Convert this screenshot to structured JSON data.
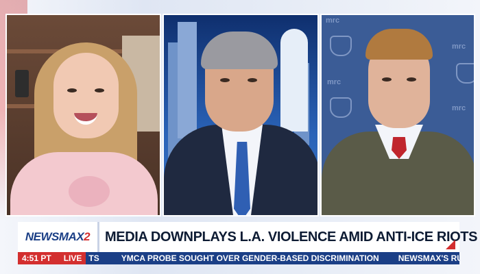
{
  "broadcast": {
    "network_logo": "NEWSMAX",
    "network_logo_num": "2",
    "headline": "MEDIA DOWNPLAYS L.A. VIOLENCE AMID ANTI-ICE RIOTS",
    "time": "4:51 PT",
    "live_label": "LIVE",
    "ticker_items": [
      "TS",
      "YMCA PROBE SOUGHT OVER GENDER-BASED DISCRIMINATION",
      "NEWSMAX'S RUD"
    ]
  },
  "backdrops": {
    "panel3_logo_text": "mrc"
  },
  "colors": {
    "brand_blue": "#1b3f86",
    "brand_red": "#d32f2f",
    "tie_red": "#c0262d",
    "tie_blue": "#2f5fb3"
  }
}
